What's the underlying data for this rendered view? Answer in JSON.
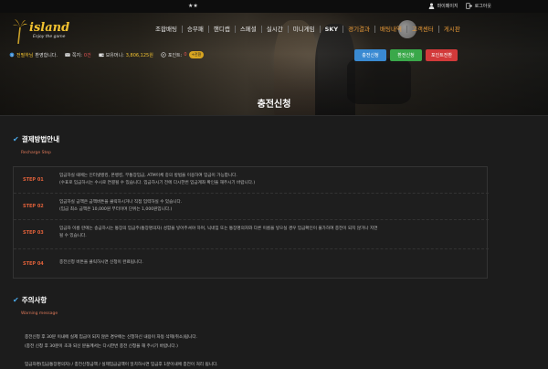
{
  "topbar": {
    "stars": "★★",
    "mypage": "마이페이지",
    "logout": "로그아웃"
  },
  "logo": {
    "name": "island",
    "tagline": "Enjoy the game"
  },
  "nav": [
    {
      "label": "조합배팅"
    },
    {
      "label": "승무패"
    },
    {
      "label": "핸디캡"
    },
    {
      "label": "스페셜"
    },
    {
      "label": "실시간"
    },
    {
      "label": "미니게임"
    },
    {
      "label": "SKY"
    },
    {
      "label": "경기결과"
    },
    {
      "label": "배팅내역"
    },
    {
      "label": "고객센터"
    },
    {
      "label": "게시판"
    }
  ],
  "infobar": {
    "greeting_name": "전필하님",
    "greeting_text": "환영합니다.",
    "notes_label": "쪽지:",
    "notes_value": "0건",
    "money_label": "보유머니:",
    "money_value": "3,806,125원",
    "point_label": "포인트:",
    "point_value": "0",
    "badge": "+전환"
  },
  "buttons": {
    "charge": "충전신청",
    "withdraw": "환전신청",
    "point_exchange": "포인트전환"
  },
  "page_title": "충전신청",
  "payment": {
    "title": "결제방법안내",
    "subtitle": "Recharge Step",
    "steps": [
      {
        "label": "STEP 01",
        "lines": [
          "입금하실 때에는 인터넷뱅킹, 폰뱅킹, 무통장입금, ATM이체 중의 방법을 이용하여 입금이 가능합니다.",
          "(수표로 입금하시는 수시로 연결될 수 있습니다. 입금하시기 전에 다시한번 입금계좌 확인을 해주시기 바랍니다.)"
        ]
      },
      {
        "label": "STEP 02",
        "lines": [
          "입금하실 금액은 금액버튼을 클릭하시거나 직접 입력하실 수 있습니다.",
          "(입금 최소 금액은 10,000원 부터이며 단위는 1,000원입니다.)"
        ]
      },
      {
        "label": "STEP 03",
        "lines": [
          "입금자 이름 란에는 송금하시는 통장의 입금주(통장명의자) 성함을 넣어주셔야 하며, 닉네임 또는 통장명의자와 다른 이름을 넣으실 경우 입금확인이 불가하여 충전이 되지 않거나 지연",
          "될 수 있습니다."
        ]
      },
      {
        "label": "STEP 04",
        "lines": [
          "충전신청 버튼을 클릭하시면 신청이 완료됩니다."
        ]
      }
    ]
  },
  "warning": {
    "title": "주의사항",
    "subtitle": "Warning message",
    "lines": [
      "충전신청 후 30분 이내에 실제 입금이 되지 않은 경우에는 신청하신 내용이 자동 삭제(취소)됩니다.",
      "(충전 신청 후 30분이 초과 되신 분들께서는 다시한번 충전 신청을 해 주시기 바랍니다.)",
      "입금자명(입금통장명의자) / 충전신청금액 / 실제입금금액이 일치하시면 입금후 1분이내에 충전이 처리 됩니다."
    ]
  },
  "colors": {
    "accent_gold": "#f2c230",
    "accent_orange": "#e0613a",
    "check_blue": "#4aa8e8",
    "btn_blue": "#3a8ad2",
    "btn_green": "#3aa84a",
    "btn_red": "#d23a3a"
  }
}
